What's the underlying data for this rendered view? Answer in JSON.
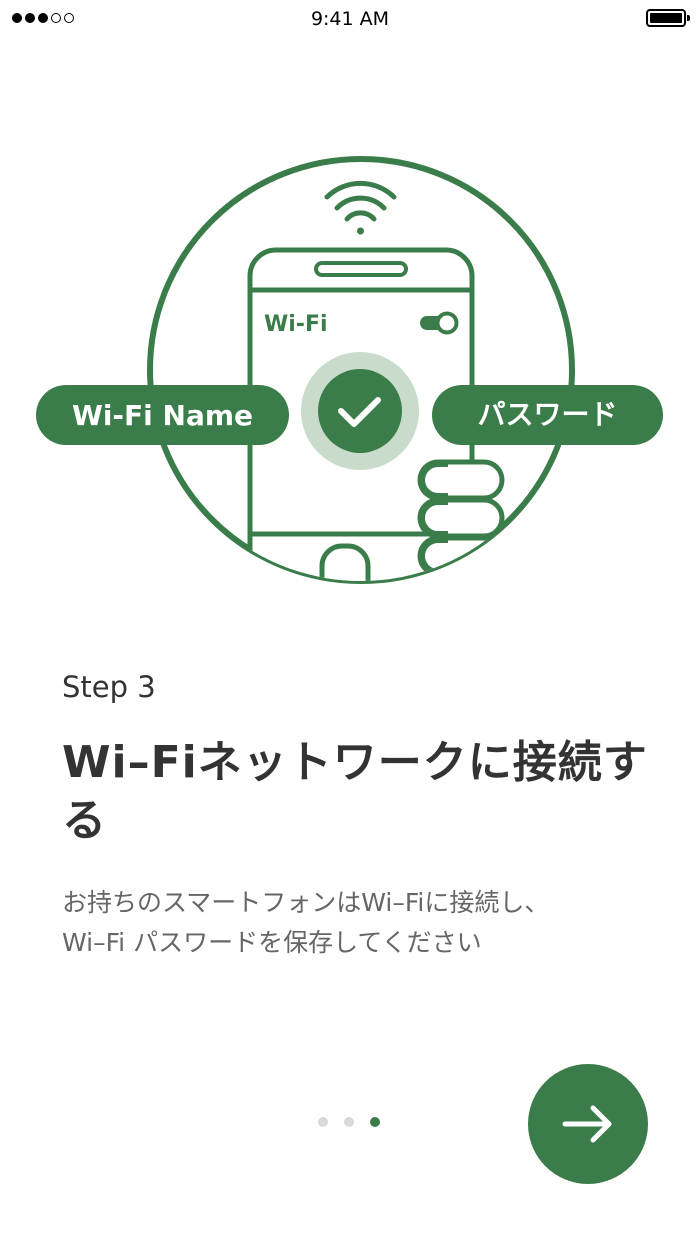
{
  "status_bar": {
    "time": "9:41 AM",
    "signal_bars": 5,
    "signal_filled": 3
  },
  "illustration": {
    "wifi_label": "Wi-Fi",
    "name_pill": "Wi-Fi Name",
    "password_pill": "パスワード",
    "icons": [
      "wifi-icon",
      "toggle-icon",
      "checkmark-icon",
      "hand-icon",
      "thumb-icon"
    ]
  },
  "content": {
    "step": "Step 3",
    "title": "Wi–Fiネットワークに接続する",
    "description": "お持ちのスマートフォンはWi–Fiに接続し、\nWi–Fi パスワードを保存してください"
  },
  "pagination": {
    "total": 3,
    "current": 3
  },
  "next_button": {
    "icon": "arrow-right-icon"
  },
  "colors": {
    "accent": "#3b7d4a",
    "accent_light": "#c9dccb",
    "text_dark": "#333333",
    "text_muted": "#666666",
    "dot_inactive": "#d9d9d9"
  }
}
